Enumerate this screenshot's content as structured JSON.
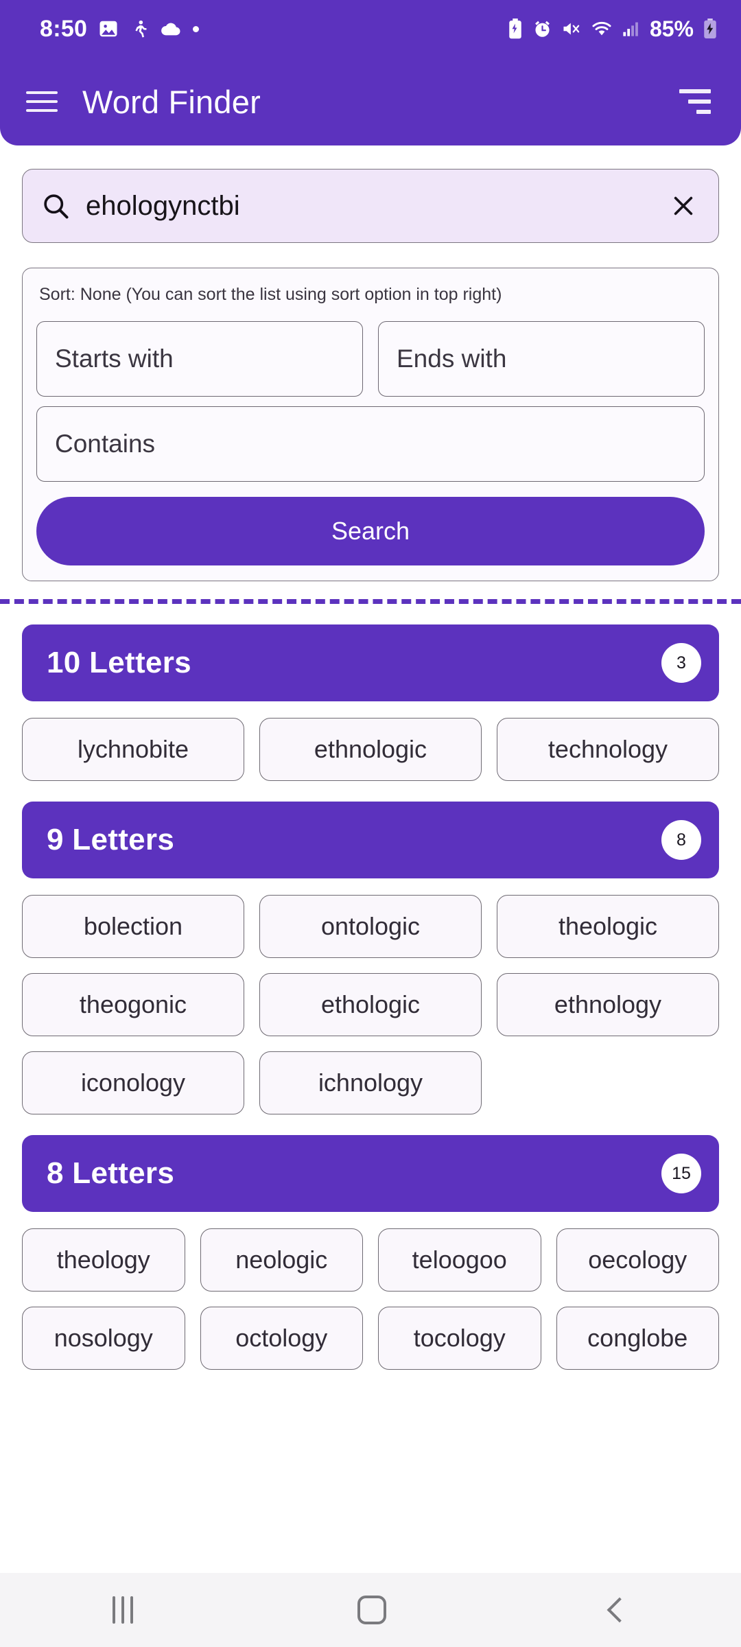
{
  "statusbar": {
    "time": "8:50",
    "battery_percent": "85%",
    "left_icons": [
      "photo-icon",
      "running-person-icon",
      "cloud-icon",
      "dot-icon"
    ],
    "right_icons": [
      "battery-saver-icon",
      "alarm-icon",
      "mute-vibrate-icon",
      "wifi-icon",
      "cellular-signal-icon",
      "battery-charging-icon"
    ]
  },
  "appbar": {
    "title": "Word Finder",
    "menu_icon": "hamburger-menu-icon",
    "sort_icon": "sort-icon"
  },
  "search": {
    "value": "ehologynctbi",
    "placeholder": "Search",
    "search_icon": "search-icon",
    "clear_icon": "close-icon"
  },
  "filters": {
    "sort_note": "Sort: None (You can sort the list using sort option in top right)",
    "starts_with_placeholder": "Starts with",
    "starts_with_value": "",
    "ends_with_placeholder": "Ends with",
    "ends_with_value": "",
    "contains_placeholder": "Contains",
    "contains_value": "",
    "search_button_label": "Search"
  },
  "colors": {
    "primary": "#5C32BE",
    "search_field_bg": "#F0E6F9",
    "chip_bg": "#FAF7FC",
    "chip_border": "#6E6A72",
    "navbar_bg": "#F5F4F6"
  },
  "results": [
    {
      "title": "10 Letters",
      "count": "3",
      "columns": 3,
      "words": [
        "lychnobite",
        "ethnologic",
        "technology"
      ]
    },
    {
      "title": "9 Letters",
      "count": "8",
      "columns": 3,
      "words": [
        "bolection",
        "ontologic",
        "theologic",
        "theogonic",
        "ethologic",
        "ethnology",
        "iconology",
        "ichnology"
      ]
    },
    {
      "title": "8 Letters",
      "count": "15",
      "columns": 4,
      "words": [
        "theology",
        "neologic",
        "teloogoo",
        "oecology",
        "nosology",
        "octology",
        "tocology",
        "conglobe"
      ]
    }
  ],
  "navbar": {
    "recents_label": "recents-icon",
    "home_label": "home-icon",
    "back_label": "back-icon"
  }
}
